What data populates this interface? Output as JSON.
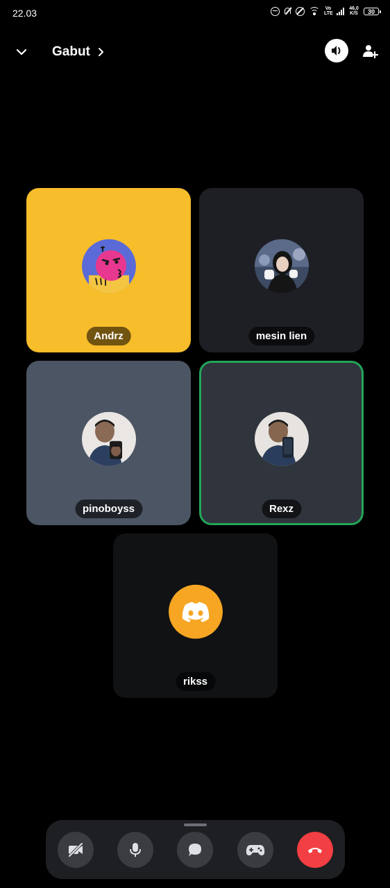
{
  "status": {
    "time": "22.03",
    "volte": "Vo LTE",
    "net_speed": "46,0 K/S",
    "battery": "30"
  },
  "header": {
    "channel_name": "Gabut"
  },
  "participants": [
    {
      "name": "Andrz",
      "speaking": false
    },
    {
      "name": "mesin lien",
      "speaking": false
    },
    {
      "name": "pinoboyss",
      "speaking": false
    },
    {
      "name": "Rexz",
      "speaking": true
    },
    {
      "name": "rikss",
      "speaking": false
    }
  ],
  "colors": {
    "accent_speaking": "#23a55a",
    "hangup": "#f23f43",
    "discord_default_avatar": "#f6a623",
    "andrz_tile": "#f7bd2a"
  }
}
